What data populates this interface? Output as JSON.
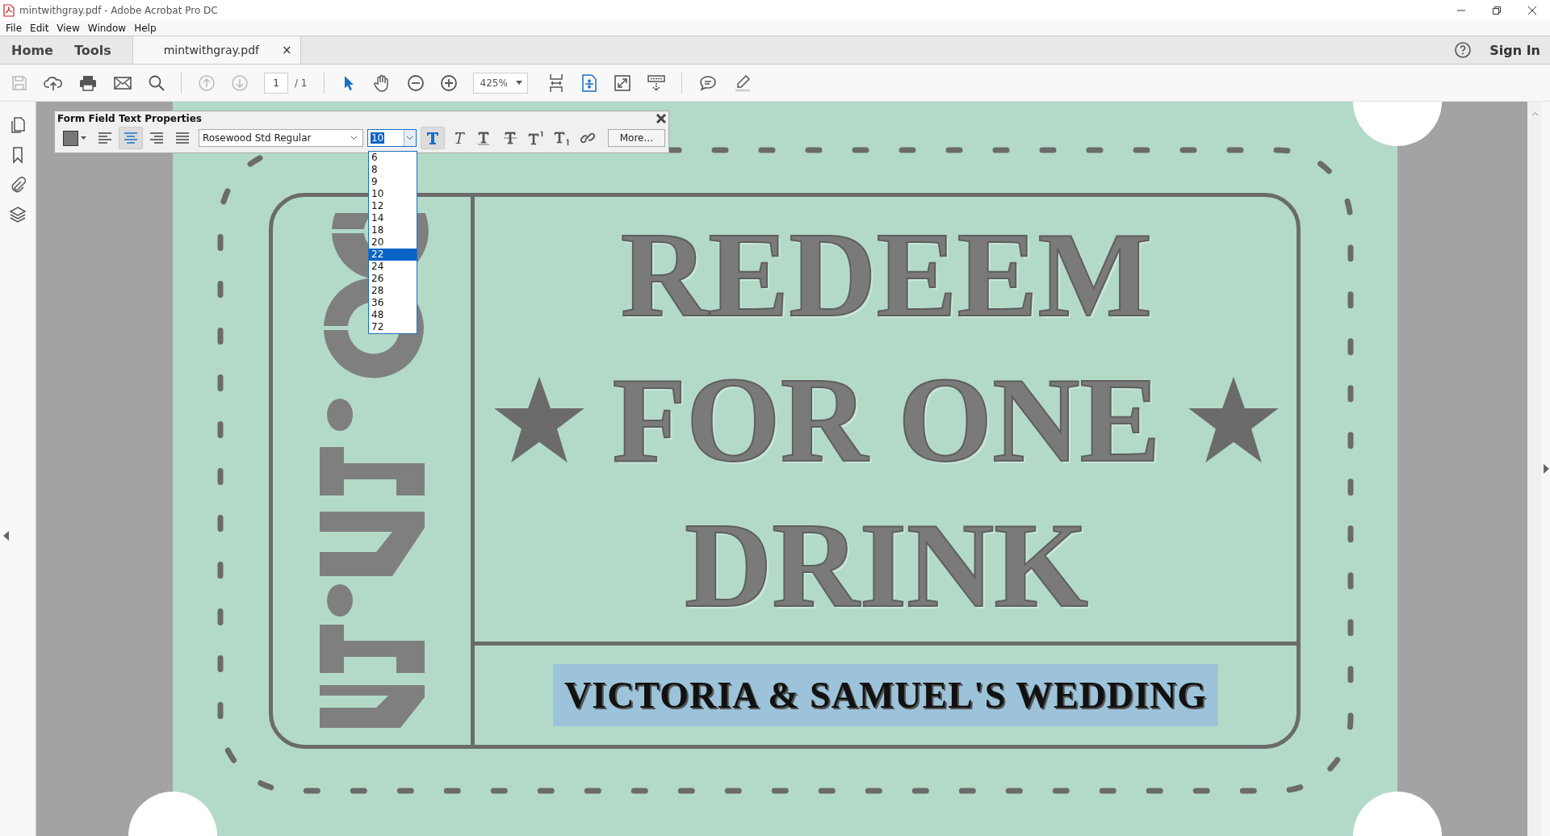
{
  "window": {
    "title": "mintwithgray.pdf - Adobe Acrobat Pro DC"
  },
  "menu": [
    "File",
    "Edit",
    "View",
    "Window",
    "Help"
  ],
  "nav_tabs": [
    {
      "label": "Home",
      "selected": false
    },
    {
      "label": "Tools",
      "selected": false
    }
  ],
  "document_tab": {
    "label": "mintwithgray.pdf",
    "close": "×",
    "selected": true
  },
  "sign_in": "Sign In",
  "toolbar": {
    "page_number": "1",
    "page_total": "/ 1",
    "zoom": "425%"
  },
  "text_properties": {
    "title": "Form Field Text Properties",
    "alignments": [
      {
        "kind": "left",
        "selected": false
      },
      {
        "kind": "center",
        "selected": true
      },
      {
        "kind": "right",
        "selected": false
      },
      {
        "kind": "justify",
        "selected": false
      }
    ],
    "font": "Rosewood Std Regular",
    "font_size": "10",
    "size_options": [
      {
        "label": "6",
        "selected": false
      },
      {
        "label": "8",
        "selected": false
      },
      {
        "label": "9",
        "selected": false
      },
      {
        "label": "10",
        "selected": false
      },
      {
        "label": "12",
        "selected": false
      },
      {
        "label": "14",
        "selected": false
      },
      {
        "label": "18",
        "selected": false
      },
      {
        "label": "20",
        "selected": false
      },
      {
        "label": "22",
        "selected": true
      },
      {
        "label": "24",
        "selected": false
      },
      {
        "label": "26",
        "selected": false
      },
      {
        "label": "28",
        "selected": false
      },
      {
        "label": "36",
        "selected": false
      },
      {
        "label": "48",
        "selected": false
      },
      {
        "label": "72",
        "selected": false
      }
    ],
    "styles": [
      {
        "kind": "bold",
        "selected": true
      },
      {
        "kind": "italic",
        "selected": false
      },
      {
        "kind": "underline",
        "selected": false
      },
      {
        "kind": "strikethrough",
        "selected": false
      },
      {
        "kind": "superscript",
        "selected": false
      },
      {
        "kind": "subscript",
        "selected": false
      },
      {
        "kind": "link",
        "selected": false
      }
    ],
    "more": "More..."
  },
  "ticket": {
    "headline": [
      "REDEEM",
      "FOR ONE",
      "DRINK"
    ],
    "caption": "VICTORIA & SAMUEL'S WEDDING",
    "caption_selected": true
  }
}
